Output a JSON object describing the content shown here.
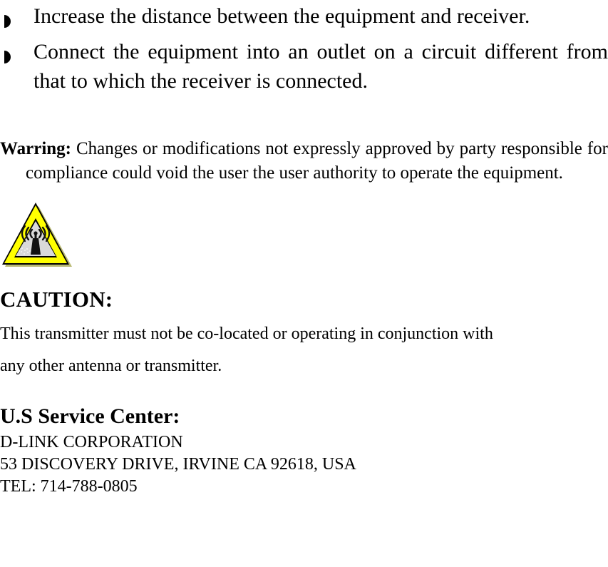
{
  "document": {
    "type": "regulatory-compliance-notice",
    "background_color": "#ffffff",
    "text_color": "#000000"
  },
  "bullets": {
    "marker_icon": "half-filled-circle-pointer-icon",
    "items": [
      {
        "id": "increase-distance",
        "text": "Increase the distance between the equipment and receiver."
      },
      {
        "id": "different-circuit",
        "text": "Connect the equipment into an outlet on a circuit different from that to which the receiver is connected."
      }
    ]
  },
  "warning": {
    "lead": "Warring:",
    "body": " Changes or modifications not expressly approved by party responsible for compliance could void the user the user authority to operate the equipment."
  },
  "warning_icon": {
    "name": "rf-radiation-warning-triangle-icon",
    "triangle_fill": "#FFFF00",
    "triangle_border": "#000000",
    "interior_fill": "#D9D9D9",
    "symbol": "rf-antenna-transmission-symbol"
  },
  "caution": {
    "heading": "CAUTION:",
    "lines": [
      "This transmitter must not be co-located or operating in conjunction with",
      "any other antenna or transmitter."
    ]
  },
  "service_center": {
    "heading": "U.S Service Center:",
    "lines": [
      "D-LINK CORPORATION",
      "53 DISCOVERY DRIVE, IRVINE CA 92618, USA",
      "TEL: 714-788-0805"
    ]
  }
}
